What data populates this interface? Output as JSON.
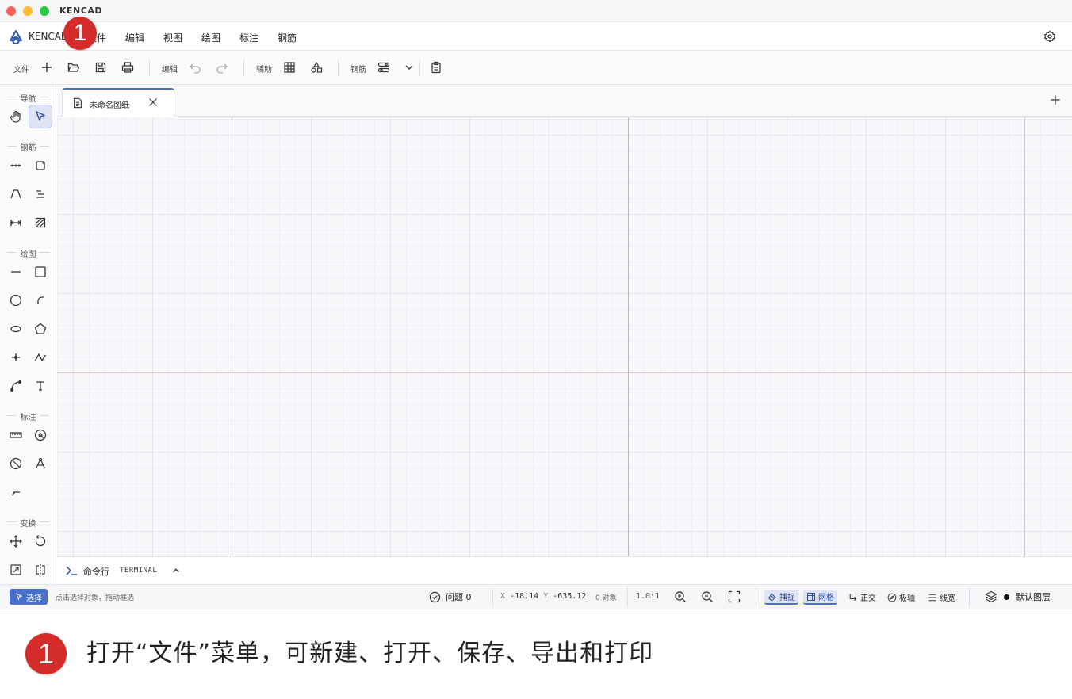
{
  "window": {
    "title": "KENCAD"
  },
  "menubar": {
    "brand": "KENCAD",
    "items": [
      "文件",
      "编辑",
      "视图",
      "绘图",
      "标注",
      "钢筋"
    ],
    "settings_icon": "gear-icon"
  },
  "toolbar": {
    "file_label": "文件",
    "edit_label": "编辑",
    "aux_label": "辅助",
    "rebar_label": "钢筋"
  },
  "sidebar": {
    "nav_label": "导航",
    "rebar_label": "钢筋",
    "draw_label": "绘图",
    "dim_label": "标注",
    "transform_label": "变换"
  },
  "tabs": {
    "active_label": "未命名图纸"
  },
  "terminal": {
    "label": "命令行",
    "sub": "TERMINAL"
  },
  "status": {
    "mode": "选择",
    "hint": "点击选择对象，拖动框选",
    "issues": "问题 0",
    "x_label": "X",
    "x_value": "-18.14",
    "y_label": "Y",
    "y_value": "-635.12",
    "objects": "0 对象",
    "scale": "1.0:1",
    "snap": "捕捉",
    "grid": "网格",
    "ortho": "正交",
    "polar": "极轴",
    "lineweight": "线宽",
    "layer": "默认图层"
  },
  "annotation": {
    "marker": "1",
    "caption": "打开“文件”菜单，可新建、打开、保存、导出和打印",
    "color": "#d42b2b"
  },
  "colors": {
    "accent": "#4a6fc8",
    "canvas": "#f8f8fa",
    "axis_x": "#e2c9d0"
  }
}
